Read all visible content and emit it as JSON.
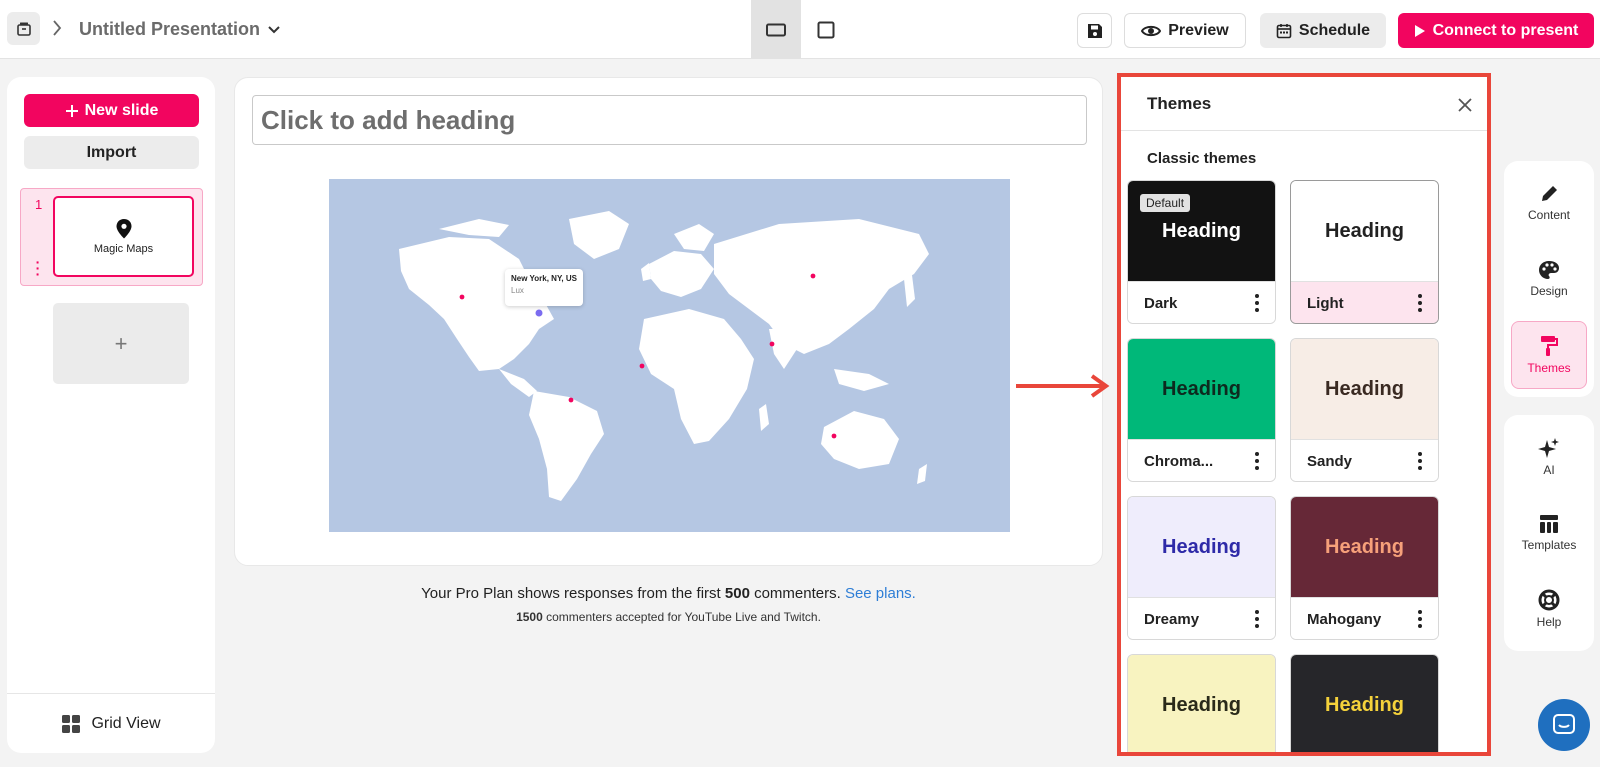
{
  "topbar": {
    "presentation_title": "Untitled Presentation",
    "preview_label": "Preview",
    "schedule_label": "Schedule",
    "connect_label": "Connect to present"
  },
  "sidebar": {
    "new_slide_label": "New slide",
    "import_label": "Import",
    "slides": [
      {
        "number": "1",
        "label": "Magic Maps"
      }
    ],
    "add_slide_label": "+",
    "grid_view_label": "Grid View"
  },
  "canvas": {
    "heading_placeholder": "Click to add heading",
    "map_tooltip": {
      "title": "New York, NY, US",
      "subtitle": "Lux"
    },
    "pro_note": {
      "prefix": "Your Pro Plan shows responses from the first ",
      "count": "500",
      "suffix": " commenters. ",
      "link": "See plans."
    },
    "pro_sub": {
      "count": "1500",
      "text": " commenters accepted for YouTube Live and Twitch."
    }
  },
  "themes": {
    "title": "Themes",
    "section_label": "Classic themes",
    "default_badge": "Default",
    "items": [
      {
        "name": "Dark",
        "heading": "Heading",
        "bg": "#121212",
        "fg": "#ffffff",
        "footer_bg": "#ffffff"
      },
      {
        "name": "Light",
        "heading": "Heading",
        "bg": "#ffffff",
        "fg": "#222222",
        "footer_bg": "#fde4ee"
      },
      {
        "name": "Chroma...",
        "heading": "Heading",
        "bg": "#00b879",
        "fg": "#0d2a1f",
        "footer_bg": "#ffffff"
      },
      {
        "name": "Sandy",
        "heading": "Heading",
        "bg": "#f7ede6",
        "fg": "#3a2a22",
        "footer_bg": "#ffffff"
      },
      {
        "name": "Dreamy",
        "heading": "Heading",
        "bg": "#efedfc",
        "fg": "#2e2aa8",
        "footer_bg": "#ffffff"
      },
      {
        "name": "Mahogany",
        "heading": "Heading",
        "bg": "#662837",
        "fg": "#f6a07a",
        "footer_bg": "#ffffff"
      },
      {
        "name": "",
        "heading": "Heading",
        "bg": "#f8f3c0",
        "fg": "#2a2a1a",
        "footer_bg": "#ffffff"
      },
      {
        "name": "",
        "heading": "Heading",
        "bg": "#26262a",
        "fg": "#f5d23b",
        "footer_bg": "#ffffff"
      }
    ]
  },
  "right_rail": {
    "group1": [
      {
        "label": "Content",
        "icon": "pencil-icon"
      },
      {
        "label": "Design",
        "icon": "palette-icon"
      },
      {
        "label": "Themes",
        "icon": "paint-roller-icon",
        "active": true
      }
    ],
    "group2": [
      {
        "label": "AI",
        "icon": "sparkles-icon"
      },
      {
        "label": "Templates",
        "icon": "templates-icon"
      },
      {
        "label": "Help",
        "icon": "lifebuoy-icon"
      }
    ]
  },
  "colors": {
    "accent": "#f2055f",
    "highlight_border": "#e9463a",
    "link": "#2e7ed6",
    "map_bg": "#b5c7e3"
  }
}
